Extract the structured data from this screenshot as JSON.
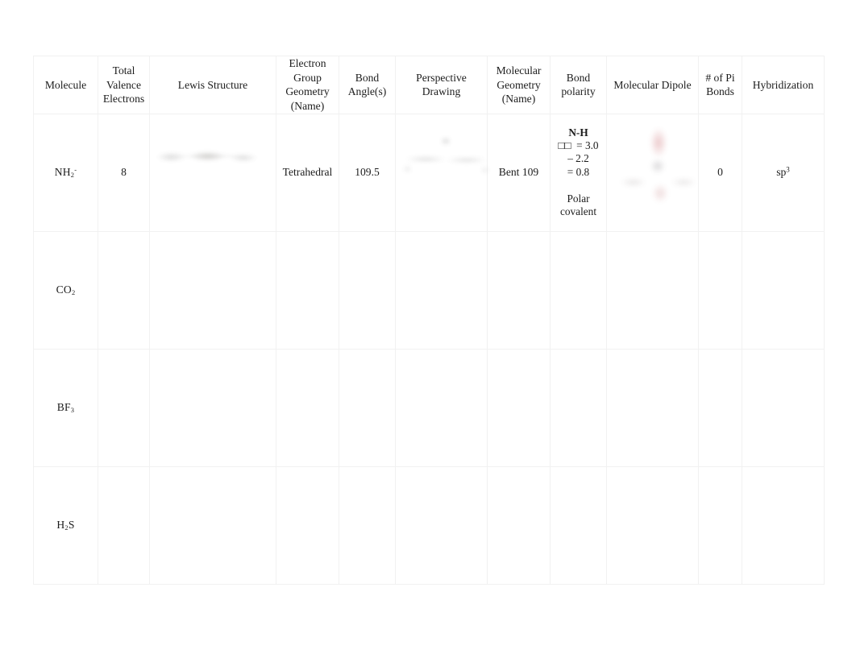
{
  "document": {
    "type": "worksheet-table",
    "background_color": "#ffffff",
    "text_color": "#1c1c1c",
    "grid_line_color": "#f1f1f1"
  },
  "table": {
    "headers": [
      {
        "name": "molecule",
        "lines": [
          "Molecule"
        ]
      },
      {
        "name": "total-valence-electrons",
        "lines": [
          "Total",
          "Valence",
          "Electrons"
        ]
      },
      {
        "name": "lewis-structure",
        "lines": [
          "Lewis Structure"
        ]
      },
      {
        "name": "electron-group-geometry",
        "lines": [
          "Electron",
          "Group",
          "Geometry",
          "(Name)"
        ]
      },
      {
        "name": "bond-angles",
        "lines": [
          "Bond",
          "Angle(s)"
        ]
      },
      {
        "name": "perspective-drawing",
        "lines": [
          "Perspective",
          "Drawing"
        ]
      },
      {
        "name": "molecular-geometry",
        "lines": [
          "Molecular",
          "Geometry",
          "(Name)"
        ]
      },
      {
        "name": "bond-polarity",
        "lines": [
          "Bond",
          "polarity"
        ]
      },
      {
        "name": "molecular-dipole",
        "lines": [
          "Molecular Dipole"
        ]
      },
      {
        "name": "number-of-pi-bonds",
        "lines": [
          "# of Pi",
          "Bonds"
        ]
      },
      {
        "name": "hybridization",
        "lines": [
          "Hybridization"
        ]
      }
    ],
    "rows": [
      {
        "id": "row-nh2-minus",
        "molecule": {
          "base": "NH",
          "sub": "2",
          "sup": "-"
        },
        "total_valence_electrons": "8",
        "lewis_structure": "",
        "electron_group_geometry": "Tetrahedral",
        "bond_angles": "109.5",
        "perspective_drawing": "",
        "molecular_geometry": "Bent 109",
        "bond_polarity": {
          "line1": "N-H",
          "line2": "□□  = 3.0",
          "line3": "– 2.2",
          "line4": "= 0.8",
          "line5": "Polar",
          "line6": "covalent"
        },
        "molecular_dipole": "",
        "number_of_pi_bonds": "0",
        "hybridization": {
          "base": "sp",
          "sup": "3"
        }
      },
      {
        "id": "row-co2",
        "molecule": {
          "base": "CO",
          "sub": "2",
          "sup": ""
        },
        "total_valence_electrons": "",
        "lewis_structure": "",
        "electron_group_geometry": "",
        "bond_angles": "",
        "perspective_drawing": "",
        "molecular_geometry": "",
        "bond_polarity": {
          "line1": "",
          "line2": "",
          "line3": "",
          "line4": "",
          "line5": "",
          "line6": ""
        },
        "molecular_dipole": "",
        "number_of_pi_bonds": "",
        "hybridization": {
          "base": "",
          "sup": ""
        }
      },
      {
        "id": "row-bf3",
        "molecule": {
          "base": "BF",
          "sub": "3",
          "sup": ""
        },
        "total_valence_electrons": "",
        "lewis_structure": "",
        "electron_group_geometry": "",
        "bond_angles": "",
        "perspective_drawing": "",
        "molecular_geometry": "",
        "bond_polarity": {
          "line1": "",
          "line2": "",
          "line3": "",
          "line4": "",
          "line5": "",
          "line6": ""
        },
        "molecular_dipole": "",
        "number_of_pi_bonds": "",
        "hybridization": {
          "base": "",
          "sup": ""
        }
      },
      {
        "id": "row-h2s",
        "molecule": {
          "base": "H",
          "sub": "2",
          "sup": "",
          "suffix": "S"
        },
        "total_valence_electrons": "",
        "lewis_structure": "",
        "electron_group_geometry": "",
        "bond_angles": "",
        "perspective_drawing": "",
        "molecular_geometry": "",
        "bond_polarity": {
          "line1": "",
          "line2": "",
          "line3": "",
          "line4": "",
          "line5": "",
          "line6": ""
        },
        "molecular_dipole": "",
        "number_of_pi_bonds": "",
        "hybridization": {
          "base": "",
          "sup": ""
        }
      }
    ]
  }
}
